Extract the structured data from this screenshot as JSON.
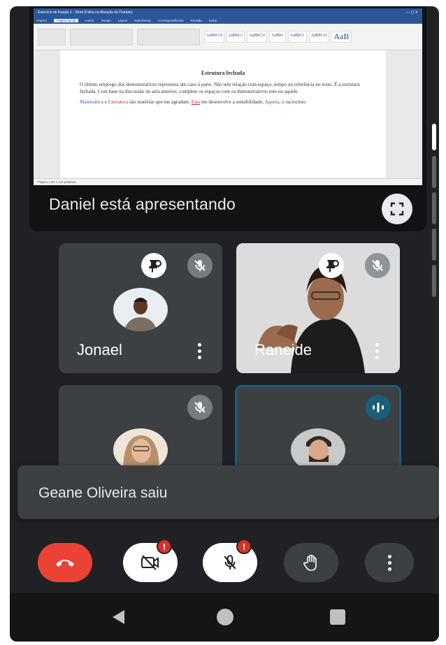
{
  "presentation": {
    "presenter_label": "Daniel está apresentando",
    "word": {
      "title": "Exercício de fixação 1 - Word (Falha na Ativação do Produto)",
      "tabs": [
        "Arquivo",
        "Página Inicial",
        "Inserir",
        "Design",
        "Layout",
        "Referências",
        "Correspondências",
        "Revisão",
        "Exibir"
      ],
      "styles": [
        "AaBbCcI",
        "AaBbCc",
        "AaBbCcI",
        "AaBbC",
        "AaBbCc",
        "AaBbCcI",
        "AaB"
      ],
      "doc_heading": "Estrutura fechada",
      "paragraph1": "O último emprego dos demonstrativos representa um caso à parte. Não tem relação com espaço, tempo ou referência no texto. É a estrutura fechada. Com base na discussão da aula anterior, complete os espaços com os demonstrativos este ou aquele.",
      "p2_part1": "Matemática",
      "p2_part2": " e ",
      "p2_part3": "Literatura",
      "p2_part4": " são matérias que me agradam: ",
      "p2_part5": "Esta",
      "p2_part6": " me desenvolve a sensibilidade; ",
      "p2_part7": "Aquela",
      "p2_part8": ", o raciocínio.",
      "status": "Página 1 de 1    141 palavras"
    }
  },
  "participants": [
    {
      "name": "Jonael"
    },
    {
      "name": "Raneide"
    },
    {
      "name": ""
    },
    {
      "name": ""
    }
  ],
  "toast": "Geane Oliveira saiu",
  "controls": {
    "alert_mark": "!"
  },
  "colors": {
    "hangup": "#ea4335",
    "alert": "#d93025",
    "speaking_border": "#1a5f7a"
  }
}
